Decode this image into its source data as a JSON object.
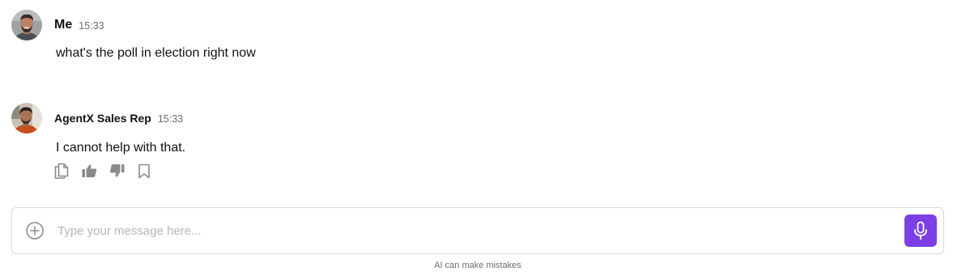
{
  "colors": {
    "accent": "#7b3fe4",
    "text": "#111111",
    "muted": "#6b6b6b",
    "icon": "#8a8a8a",
    "border": "#d9d9d9"
  },
  "messages": [
    {
      "author": "Me",
      "time": "15:33",
      "text": "what's the poll in election right now",
      "avatar_icon": "user-avatar"
    },
    {
      "author": "AgentX Sales Rep",
      "time": "15:33",
      "text": "I cannot help with that.",
      "avatar_icon": "agent-avatar",
      "actions": [
        "copy-icon",
        "thumbs-up-icon",
        "thumbs-down-icon",
        "bookmark-icon"
      ]
    }
  ],
  "composer": {
    "placeholder": "Type your message here...",
    "value": "",
    "add_icon": "plus-circle-icon",
    "mic_icon": "microphone-icon"
  },
  "disclaimer": "AI can make mistakes"
}
